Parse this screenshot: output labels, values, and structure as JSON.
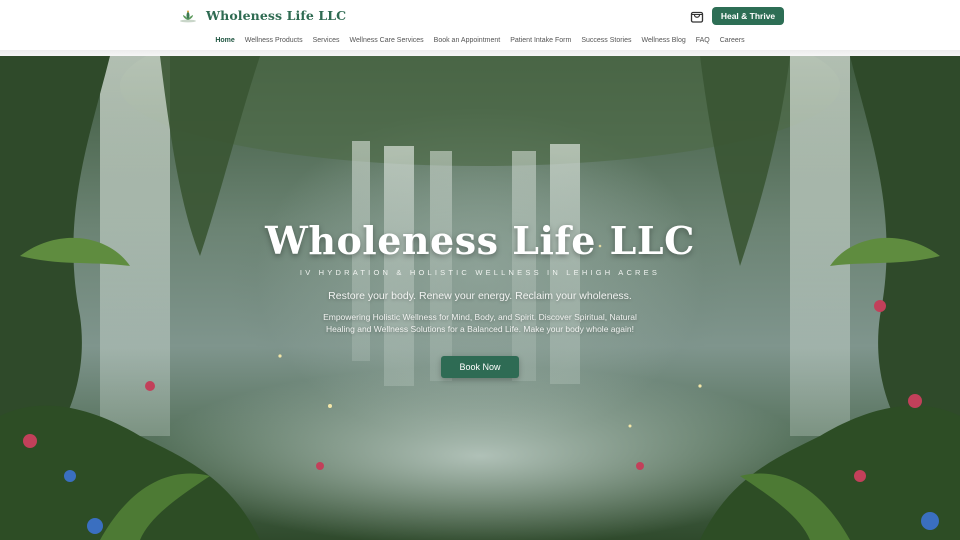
{
  "header": {
    "brand": "Wholeness Life LLC",
    "cta_label": "Heal & Thrive",
    "icons": {
      "logo": "leaf-logo-icon",
      "cart": "shopping-bag-icon"
    }
  },
  "nav": {
    "items": [
      {
        "label": "Home",
        "active": true
      },
      {
        "label": "Wellness Products"
      },
      {
        "label": "Services"
      },
      {
        "label": "Wellness Care Services"
      },
      {
        "label": "Book an Appointment"
      },
      {
        "label": "Patient Intake Form"
      },
      {
        "label": "Success Stories"
      },
      {
        "label": "Wellness Blog"
      },
      {
        "label": "FAQ"
      },
      {
        "label": "Careers"
      }
    ]
  },
  "hero": {
    "title": "Wholeness Life LLC",
    "tagline": "IV HYDRATION & HOLISTIC WELLNESS IN LEHIGH ACRES",
    "lead": "Restore your body. Renew your energy. Reclaim your wholeness.",
    "description": "Empowering Holistic Wellness for Mind, Body, and Spirit. Discover Spiritual, Natural Healing and Wellness Solutions for a Balanced Life. Make your body whole again!",
    "button_label": "Book Now",
    "background": "jungle-waterfall-image"
  },
  "colors": {
    "brand_green": "#2d6e55",
    "brand_text": "#2f6b52",
    "nav_text": "#555555"
  }
}
